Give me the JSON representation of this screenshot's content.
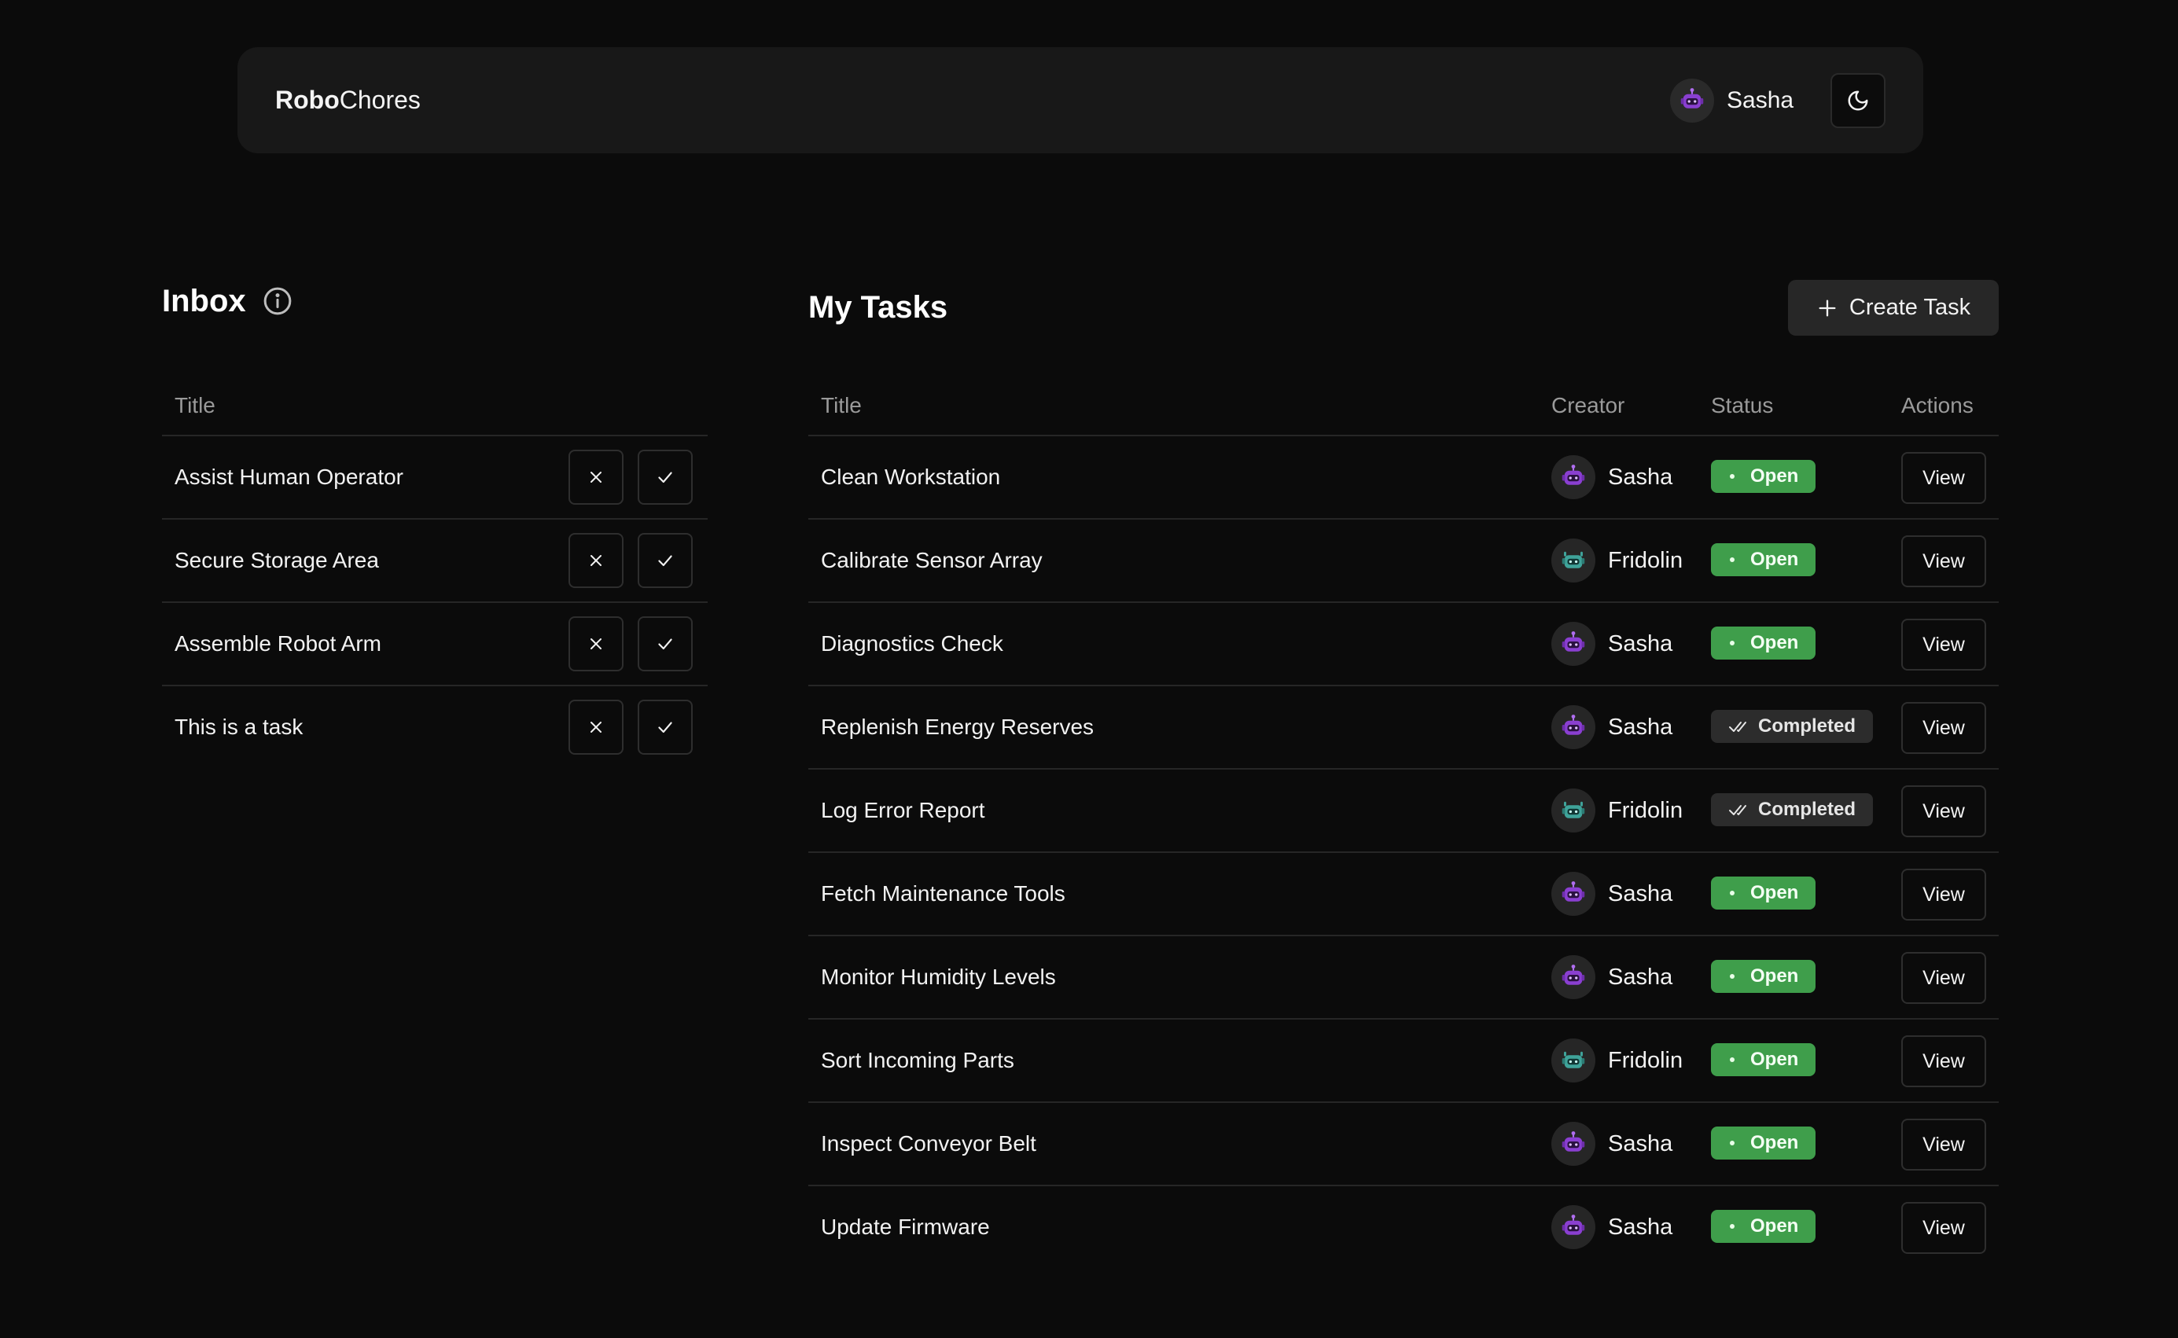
{
  "app": {
    "brand_bold": "Robo",
    "brand_light": "Chores"
  },
  "header": {
    "user_name": "Sasha",
    "theme_icon": "moon-icon"
  },
  "inbox": {
    "title": "Inbox",
    "column_title": "Title",
    "items": [
      {
        "title": "Assist Human Operator"
      },
      {
        "title": "Secure Storage Area"
      },
      {
        "title": "Assemble Robot Arm"
      },
      {
        "title": "This is a task"
      }
    ]
  },
  "tasks": {
    "title": "My Tasks",
    "create_label": "Create Task",
    "columns": {
      "title": "Title",
      "creator": "Creator",
      "status": "Status",
      "actions": "Actions"
    },
    "view_label": "View",
    "rows": [
      {
        "title": "Clean Workstation",
        "creator": "Sasha",
        "status": "Open"
      },
      {
        "title": "Calibrate Sensor Array",
        "creator": "Fridolin",
        "status": "Open"
      },
      {
        "title": "Diagnostics Check",
        "creator": "Sasha",
        "status": "Open"
      },
      {
        "title": "Replenish Energy Reserves",
        "creator": "Sasha",
        "status": "Completed"
      },
      {
        "title": "Log Error Report",
        "creator": "Fridolin",
        "status": "Completed"
      },
      {
        "title": "Fetch Maintenance Tools",
        "creator": "Sasha",
        "status": "Open"
      },
      {
        "title": "Monitor Humidity Levels",
        "creator": "Sasha",
        "status": "Open"
      },
      {
        "title": "Sort Incoming Parts",
        "creator": "Fridolin",
        "status": "Open"
      },
      {
        "title": "Inspect Conveyor Belt",
        "creator": "Sasha",
        "status": "Open"
      },
      {
        "title": "Update Firmware",
        "creator": "Sasha",
        "status": "Open"
      }
    ]
  },
  "colors": {
    "background": "#0b0b0b",
    "surface": "#181818",
    "open_badge": "#3f9e4b",
    "completed_badge": "#2c2c2c",
    "avatar_sasha": "#8a3fd1",
    "avatar_fridolin": "#3fa39a"
  }
}
